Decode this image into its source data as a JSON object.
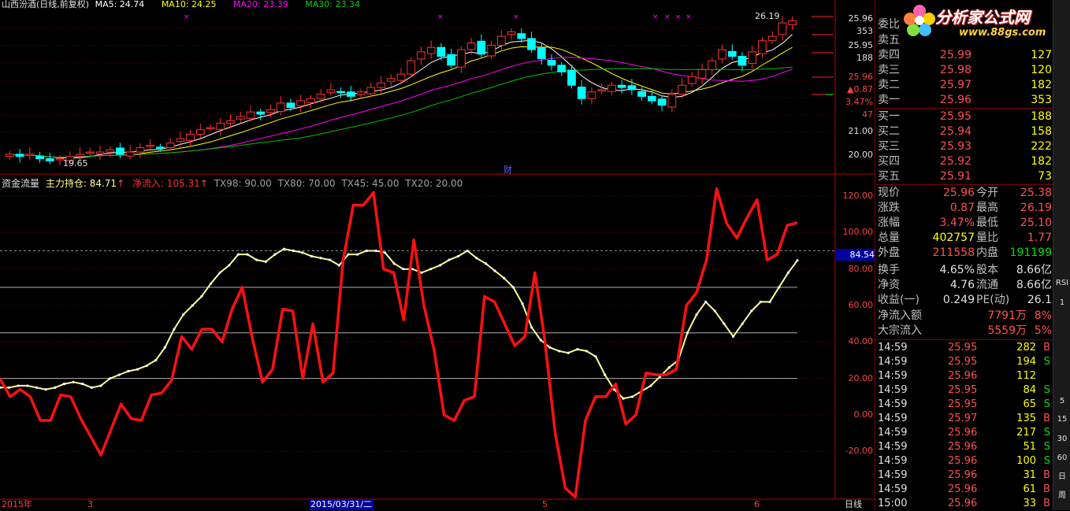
{
  "upper": {
    "title": "山西汾酒(日线,前复权)",
    "ma5": "MA5: 24.74",
    "ma10": "MA10: 24.25",
    "ma20": "MA20: 23.39",
    "ma30": "MA30: 23.34",
    "high_label": "26.19",
    "low_label": "19.65",
    "event_label": "财",
    "price_axis": [
      "25.96",
      "353",
      "25.95",
      "188",
      "25.96",
      "▲0.87",
      "3.47%",
      "47",
      "21.00",
      "20.00"
    ]
  },
  "lower": {
    "title": "资金流量",
    "holding": "主力持仓: 84.71",
    "inflow": "净流入: 105.31",
    "tx98": "TX98: 90.00",
    "tx80": "TX80: 70.00",
    "tx45": "TX45: 45.00",
    "tx20": "TX20: 20.00",
    "axis": [
      "120.00",
      "100.00",
      "80.00",
      "60.00",
      "40.00",
      "20.00",
      "0.00",
      "-20.00"
    ],
    "current_value": "84.54"
  },
  "xaxis": {
    "labels": [
      "2015年",
      "3",
      "2015/03/31/二",
      "5",
      "6"
    ],
    "period": "日线"
  },
  "quote": {
    "weibi_label": "委比",
    "sell": [
      {
        "label": "卖五",
        "price": "",
        "vol": ""
      },
      {
        "label": "卖四",
        "price": "25.99",
        "vol": "127"
      },
      {
        "label": "卖三",
        "price": "25.98",
        "vol": "120"
      },
      {
        "label": "卖二",
        "price": "25.97",
        "vol": "182"
      },
      {
        "label": "卖一",
        "price": "25.96",
        "vol": "353"
      }
    ],
    "buy": [
      {
        "label": "买一",
        "price": "25.95",
        "vol": "188"
      },
      {
        "label": "买二",
        "price": "25.94",
        "vol": "158"
      },
      {
        "label": "买三",
        "price": "25.93",
        "vol": "222"
      },
      {
        "label": "买四",
        "price": "25.92",
        "vol": "182"
      },
      {
        "label": "买五",
        "price": "25.91",
        "vol": "73"
      }
    ],
    "stats": [
      {
        "l1": "现价",
        "v1": "25.96",
        "l2": "今开",
        "v2": "25.38"
      },
      {
        "l1": "涨跌",
        "v1": "0.87",
        "l2": "最高",
        "v2": "26.19"
      },
      {
        "l1": "涨幅",
        "v1": "3.47%",
        "l2": "最低",
        "v2": "25.10"
      },
      {
        "l1": "总量",
        "v1": "402757",
        "l2": "量比",
        "v2": "1.77"
      },
      {
        "l1": "外盘",
        "v1": "211558",
        "l2": "内盘",
        "v2": "191199"
      },
      {
        "l1": "换手",
        "v1": "4.65%",
        "l2": "股本",
        "v2": "8.66亿"
      },
      {
        "l1": "净资",
        "v1": "4.76",
        "l2": "流通",
        "v2": "8.66亿"
      },
      {
        "l1": "收益(一)",
        "v1": "0.249",
        "l2": "PE(动)",
        "v2": "26.1"
      }
    ],
    "net_inflow": {
      "label": "净流入额",
      "value": "7791万",
      "pct": "8%"
    },
    "block_inflow": {
      "label": "大宗流入",
      "value": "5559万",
      "pct": "5%"
    },
    "ticks": [
      {
        "t": "14:59",
        "p": "25.95",
        "v": "282",
        "d": "B"
      },
      {
        "t": "14:59",
        "p": "25.95",
        "v": "194",
        "d": "S"
      },
      {
        "t": "14:59",
        "p": "25.96",
        "v": "112",
        "d": ""
      },
      {
        "t": "14:59",
        "p": "25.95",
        "v": "84",
        "d": "S"
      },
      {
        "t": "14:59",
        "p": "25.95",
        "v": "65",
        "d": "S"
      },
      {
        "t": "14:59",
        "p": "25.97",
        "v": "135",
        "d": "B"
      },
      {
        "t": "14:59",
        "p": "25.96",
        "v": "217",
        "d": "S"
      },
      {
        "t": "14:59",
        "p": "25.96",
        "v": "51",
        "d": "S"
      },
      {
        "t": "14:59",
        "p": "25.96",
        "v": "100",
        "d": "S"
      },
      {
        "t": "14:59",
        "p": "25.96",
        "v": "31",
        "d": "B"
      },
      {
        "t": "14:59",
        "p": "25.96",
        "v": "61",
        "d": "B"
      },
      {
        "t": "15:00",
        "p": "25.96",
        "v": "33",
        "d": "B"
      }
    ]
  },
  "watermark": {
    "name": "分析家公式网",
    "url": "www.88gs.com"
  },
  "sidebar": [
    "RSI",
    "1",
    "5",
    "15",
    "30",
    "60",
    "日",
    "周"
  ],
  "colors": {
    "up": "#ff3030",
    "down": "#00ffff",
    "ma5": "#ffffff",
    "ma10": "#ffff00",
    "ma20": "#ff00ff",
    "ma30": "#00c000",
    "flow_red": "#ff1010",
    "flow_yellow": "#ffff90"
  },
  "chart_data": {
    "type": "line",
    "title": "资金流量",
    "ylim": [
      -30,
      130
    ],
    "series": [
      {
        "name": "主力持仓",
        "values": [
          15,
          15,
          16,
          16,
          15,
          14,
          15,
          17,
          18,
          17,
          15,
          16,
          20,
          22,
          24,
          25,
          27,
          30,
          37,
          47,
          55,
          60,
          65,
          72,
          78,
          82,
          88,
          88,
          85,
          84,
          88,
          91,
          90,
          89,
          87,
          86,
          85,
          82,
          88,
          88,
          90,
          90,
          89,
          83,
          80,
          80,
          78,
          80,
          82,
          85,
          87,
          90,
          86,
          83,
          79,
          75,
          70,
          61,
          48,
          41,
          37,
          35,
          34,
          36,
          35,
          32,
          22,
          14,
          9,
          10,
          13,
          16,
          21,
          26,
          30,
          45,
          55,
          62,
          57,
          50,
          43,
          50,
          57,
          62,
          62,
          70,
          78,
          84.71
        ]
      },
      {
        "name": "净流入",
        "values": [
          20,
          10,
          14,
          10,
          -3,
          -3,
          11,
          10,
          -2,
          -12,
          -22,
          -8,
          6,
          -2,
          -3,
          11,
          12,
          19,
          43,
          36,
          47,
          47,
          40,
          58,
          70,
          42,
          18,
          25,
          58,
          57,
          20,
          50,
          18,
          23,
          85,
          115,
          115,
          122,
          80,
          78,
          52,
          96,
          60,
          36,
          0,
          -3,
          8,
          10,
          65,
          62,
          50,
          38,
          43,
          78,
          40,
          -10,
          -40,
          -45,
          -3,
          10,
          10,
          17,
          -5,
          0,
          23,
          22,
          22,
          25,
          60,
          67,
          85,
          124,
          105,
          97,
          108,
          118,
          85,
          88,
          104,
          105.31
        ]
      }
    ]
  }
}
